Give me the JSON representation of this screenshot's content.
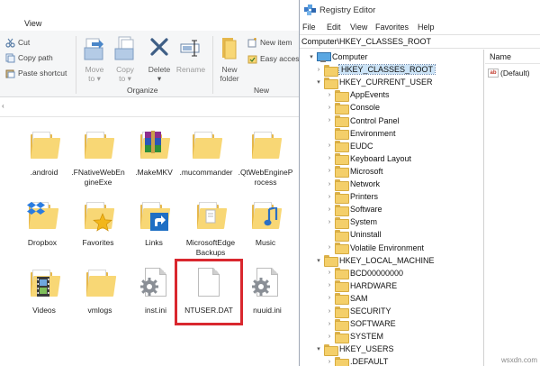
{
  "explorer": {
    "menus": [
      "View"
    ],
    "ribbon": {
      "clipboard": {
        "cut": "Cut",
        "copy_path": "Copy path",
        "paste_shortcut": "Paste shortcut"
      },
      "organize": {
        "move_to": "Move\nto ▾",
        "copy_to": "Copy\nto ▾",
        "delete": "Delete\n▾",
        "rename": "Rename",
        "label": "Organize"
      },
      "new": {
        "new_folder": "New\nfolder",
        "new_item": "New item",
        "easy_access": "Easy acces",
        "label": "New"
      }
    },
    "files": [
      {
        "name": ".android",
        "type": "folder"
      },
      {
        "name": ".FNativeWebEngineExe",
        "type": "folder"
      },
      {
        "name": ".MakeMKV",
        "type": "folder-winrar"
      },
      {
        "name": ".mucommander",
        "type": "folder"
      },
      {
        "name": ".QtWebEngineProcess",
        "type": "folder"
      },
      {
        "name": "Dropbox",
        "type": "folder-dropbox"
      },
      {
        "name": "Favorites",
        "type": "folder-star"
      },
      {
        "name": "Links",
        "type": "folder-arrow"
      },
      {
        "name": "MicrosoftEdgeBackups",
        "type": "folder-doc"
      },
      {
        "name": "Music",
        "type": "folder-music"
      },
      {
        "name": "Videos",
        "type": "folder-video"
      },
      {
        "name": "vmlogs",
        "type": "folder"
      },
      {
        "name": "inst.ini",
        "type": "gear"
      },
      {
        "name": "NTUSER.DAT",
        "type": "file"
      },
      {
        "name": "nuuid.ini",
        "type": "gear"
      }
    ]
  },
  "regedit": {
    "title": "Registry Editor",
    "menus": [
      "File",
      "Edit",
      "View",
      "Favorites",
      "Help"
    ],
    "address": "Computer\\HKEY_CLASSES_ROOT",
    "tree": [
      {
        "label": "Computer",
        "level": 0,
        "exp": "▾",
        "icon": "pc"
      },
      {
        "label": "HKEY_CLASSES_ROOT",
        "level": 1,
        "exp": "›",
        "icon": "folder",
        "selected": true
      },
      {
        "label": "HKEY_CURRENT_USER",
        "level": 1,
        "exp": "▾",
        "icon": "folder"
      },
      {
        "label": "AppEvents",
        "level": 2,
        "exp": "›",
        "icon": "folder"
      },
      {
        "label": "Console",
        "level": 2,
        "exp": "›",
        "icon": "folder"
      },
      {
        "label": "Control Panel",
        "level": 2,
        "exp": "›",
        "icon": "folder"
      },
      {
        "label": "Environment",
        "level": 2,
        "exp": "",
        "icon": "folder"
      },
      {
        "label": "EUDC",
        "level": 2,
        "exp": "›",
        "icon": "folder"
      },
      {
        "label": "Keyboard Layout",
        "level": 2,
        "exp": "›",
        "icon": "folder"
      },
      {
        "label": "Microsoft",
        "level": 2,
        "exp": "›",
        "icon": "folder"
      },
      {
        "label": "Network",
        "level": 2,
        "exp": "›",
        "icon": "folder"
      },
      {
        "label": "Printers",
        "level": 2,
        "exp": "›",
        "icon": "folder"
      },
      {
        "label": "Software",
        "level": 2,
        "exp": "›",
        "icon": "folder"
      },
      {
        "label": "System",
        "level": 2,
        "exp": "›",
        "icon": "folder"
      },
      {
        "label": "Uninstall",
        "level": 2,
        "exp": "",
        "icon": "folder"
      },
      {
        "label": "Volatile Environment",
        "level": 2,
        "exp": "›",
        "icon": "folder"
      },
      {
        "label": "HKEY_LOCAL_MACHINE",
        "level": 1,
        "exp": "▾",
        "icon": "folder"
      },
      {
        "label": "BCD00000000",
        "level": 2,
        "exp": "›",
        "icon": "folder"
      },
      {
        "label": "HARDWARE",
        "level": 2,
        "exp": "›",
        "icon": "folder"
      },
      {
        "label": "SAM",
        "level": 2,
        "exp": "›",
        "icon": "folder"
      },
      {
        "label": "SECURITY",
        "level": 2,
        "exp": "›",
        "icon": "folder"
      },
      {
        "label": "SOFTWARE",
        "level": 2,
        "exp": "›",
        "icon": "folder"
      },
      {
        "label": "SYSTEM",
        "level": 2,
        "exp": "›",
        "icon": "folder"
      },
      {
        "label": "HKEY_USERS",
        "level": 1,
        "exp": "▾",
        "icon": "folder"
      },
      {
        "label": ".DEFAULT",
        "level": 2,
        "exp": "›",
        "icon": "folder"
      }
    ],
    "list": {
      "header": "Name",
      "rows": [
        {
          "name": "(Default)",
          "icon": "ab"
        }
      ]
    }
  },
  "watermark": "wsxdn.com",
  "colors": {
    "highlight_box": "#d9272e",
    "folder_front": "#f8d775",
    "folder_back": "#e6b84c",
    "selection": "#cce4f7"
  }
}
